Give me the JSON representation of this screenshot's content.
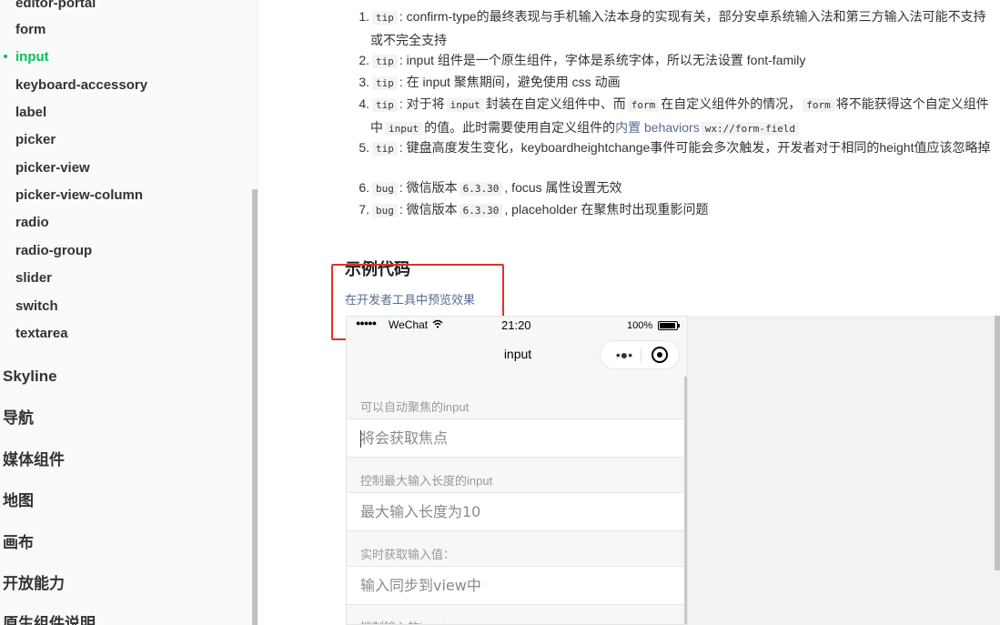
{
  "sidebar": {
    "sub_items": [
      {
        "label": "editor-portal"
      },
      {
        "label": "form"
      },
      {
        "label": "input",
        "active": true
      },
      {
        "label": "keyboard-accessory"
      },
      {
        "label": "label"
      },
      {
        "label": "picker"
      },
      {
        "label": "picker-view"
      },
      {
        "label": "picker-view-column"
      },
      {
        "label": "radio"
      },
      {
        "label": "radio-group"
      },
      {
        "label": "slider"
      },
      {
        "label": "switch"
      },
      {
        "label": "textarea"
      }
    ],
    "top_items": [
      {
        "label": "Skyline"
      },
      {
        "label": "导航"
      },
      {
        "label": "媒体组件"
      },
      {
        "label": "地图"
      },
      {
        "label": "画布"
      },
      {
        "label": "开放能力"
      },
      {
        "label": "原生组件说明"
      }
    ]
  },
  "notes": [
    {
      "num": "1.",
      "tag": "tip",
      "text": ": confirm-type的最终表现与手机输入法本身的实现有关，部分安卓系统输入法和第三方输入法可能不支持或不完全支持"
    },
    {
      "num": "2.",
      "tag": "tip",
      "text": ": input 组件是一个原生组件，字体是系统字体，所以无法设置 font-family"
    },
    {
      "num": "3.",
      "tag": "tip",
      "text": ": 在 input 聚焦期间，避免使用 css 动画"
    },
    {
      "num": "4.",
      "tag": "tip",
      "parts": {
        "a": ": 对于将",
        "code1": "input",
        "b": "封装在自定义组件中、而",
        "code2": "form",
        "c": "在自定义组件外的情况，",
        "code3": "form",
        "d": "将不能获得这个自定义组件中",
        "code4": "input",
        "e": "的值。此时需要使用自定义组件的",
        "link": "内置 behaviors",
        "code5": "wx://form-field"
      }
    },
    {
      "num": "5.",
      "tag": "tip",
      "text": ": 键盘高度发生变化，keyboardheightchange事件可能会多次触发，开发者对于相同的height值应该忽略掉"
    },
    {
      "num": "6.",
      "tag": "bug",
      "before": ": 微信版本",
      "version": "6.3.30",
      "after": ", focus 属性设置无效"
    },
    {
      "num": "7.",
      "tag": "bug",
      "before": ": 微信版本",
      "version": "6.3.30",
      "after": ", placeholder 在聚焦时出现重影问题"
    }
  ],
  "section": {
    "title": "示例代码",
    "preview_link": "在开发者工具中预览效果"
  },
  "phone": {
    "status": {
      "signal": "●●●●●",
      "carrier": "WeChat",
      "wifi_icon": "wifi-icon",
      "time": "21:20",
      "battery": "100%"
    },
    "nav_title": "input",
    "capsule_more": "•●•",
    "fields": [
      {
        "label": "可以自动聚焦的input",
        "placeholder": "将会获取焦点",
        "focused": true
      },
      {
        "label": "控制最大输入长度的input",
        "placeholder": "最大输入长度为10"
      },
      {
        "label": "实时获取输入值：",
        "placeholder": "输入同步到view中"
      },
      {
        "label": "控制输入的input"
      }
    ]
  },
  "colors": {
    "accent": "#07c160",
    "link": "#576b95",
    "highlight_box": "#e0312e"
  }
}
